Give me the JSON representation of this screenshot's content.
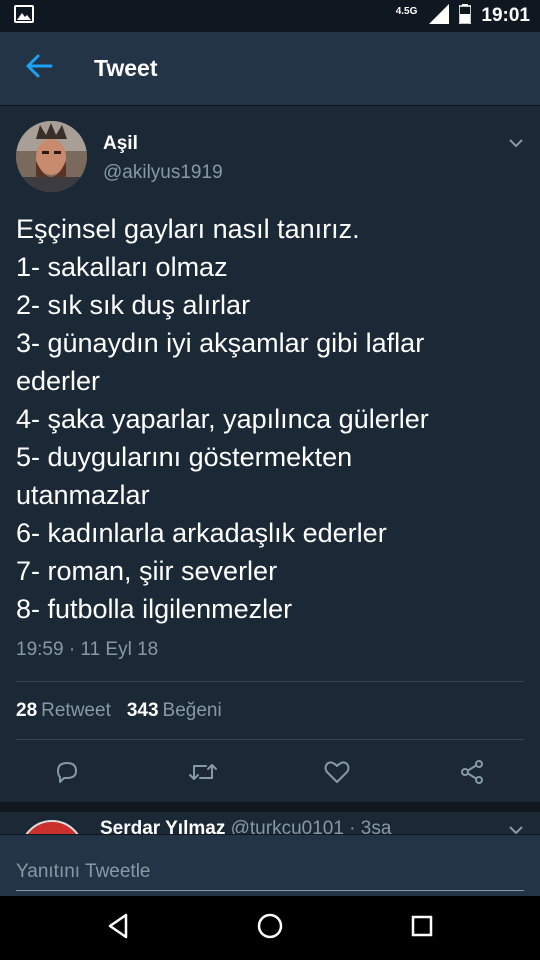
{
  "status_bar": {
    "network_type": "4.5G",
    "time": "19:01"
  },
  "app_bar": {
    "title": "Tweet"
  },
  "tweet": {
    "author_name": "Aşil",
    "author_handle": "@akilyus1919",
    "text_lines": [
      "Eşçinsel gayları nasıl tanırız.",
      "1- sakalları olmaz",
      "2- sık sık duş alırlar",
      "3- günaydın iyi akşamlar gibi laflar",
      "ederler",
      "4- şaka yaparlar, yapılınca gülerler",
      "5- duygularını göstermekten",
      "utanmazlar",
      "6- kadınlarla arkadaşlık ederler",
      "7- roman, şiir severler",
      "8- futbolla ilgilenmezler"
    ],
    "timestamp": "19:59 · 11 Eyl 18",
    "retweet_count": "28",
    "retweet_label": "Retweet",
    "like_count": "343",
    "like_label": "Beğeni"
  },
  "reply_preview": {
    "name": "Serdar Yılmaz",
    "meta": "@turkcu0101 · 3sa"
  },
  "compose": {
    "placeholder": "Yanıtını Tweetle"
  },
  "colors": {
    "background": "#141d26",
    "tweet_background": "#1b2836",
    "bar_background": "#243447",
    "accent": "#1da1f2",
    "secondary_text": "#8899a6"
  }
}
